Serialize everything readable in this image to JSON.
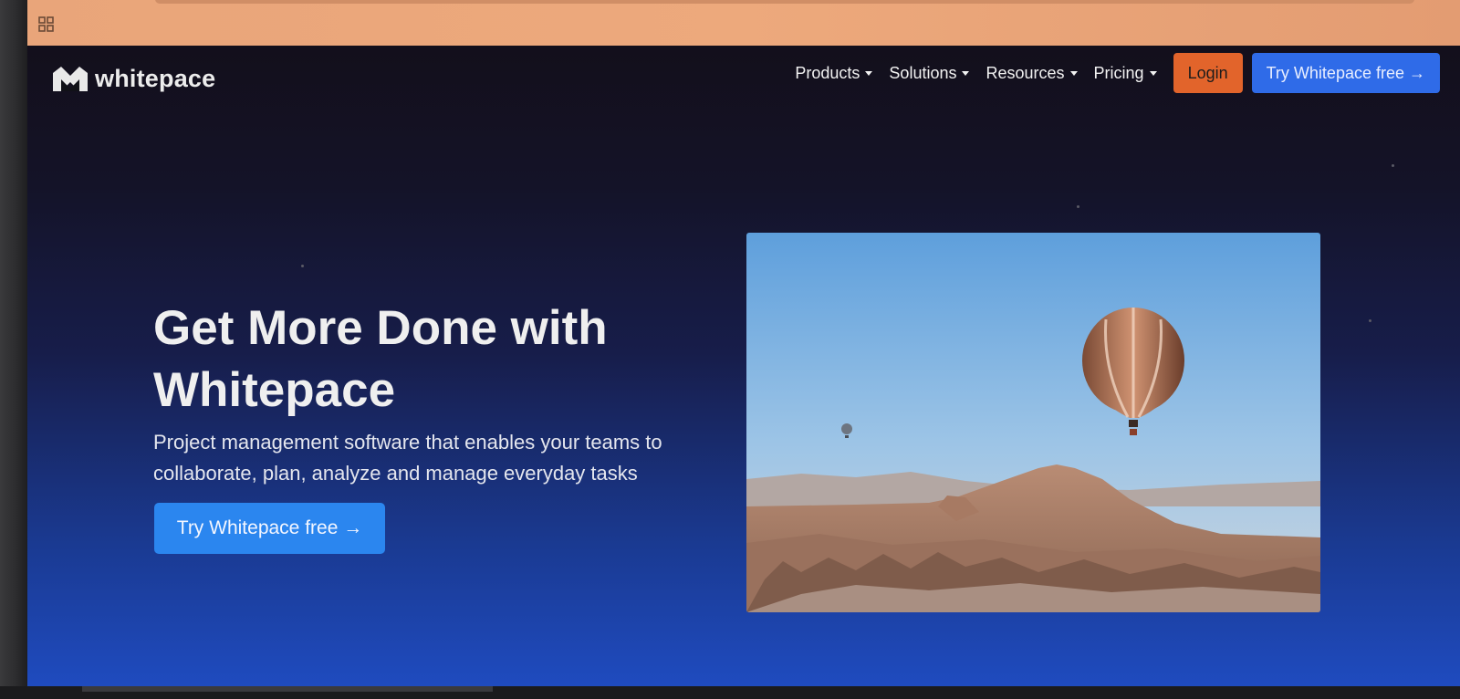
{
  "site": {
    "logo_text": "whitepace"
  },
  "nav": {
    "items": [
      {
        "label": "Products"
      },
      {
        "label": "Solutions"
      },
      {
        "label": "Resources"
      },
      {
        "label": "Pricing"
      }
    ],
    "login_label": "Login",
    "try_label": "Try Whitepace free →"
  },
  "hero": {
    "title_line1": "Get More Done with",
    "title_line2": "Whitepace",
    "subtitle_line1": "Project management software that enables your teams to",
    "subtitle_line2": "collaborate, plan, analyze and manage everyday tasks",
    "cta_label": "Try Whitepace free →",
    "image": "hot-air-balloon-over-canyon-photo"
  },
  "colors": {
    "browser_bar": "#eba77b",
    "page_top": "#130f1b",
    "page_bottom": "#1f4bbf",
    "login_button": "#e2642b",
    "primary_button": "#2f6be8",
    "cta_button": "#2b86ef"
  },
  "icons": {
    "apps": "apps-grid-icon",
    "logo": "whitepace-logo-icon",
    "caret": "caret-down-icon"
  }
}
